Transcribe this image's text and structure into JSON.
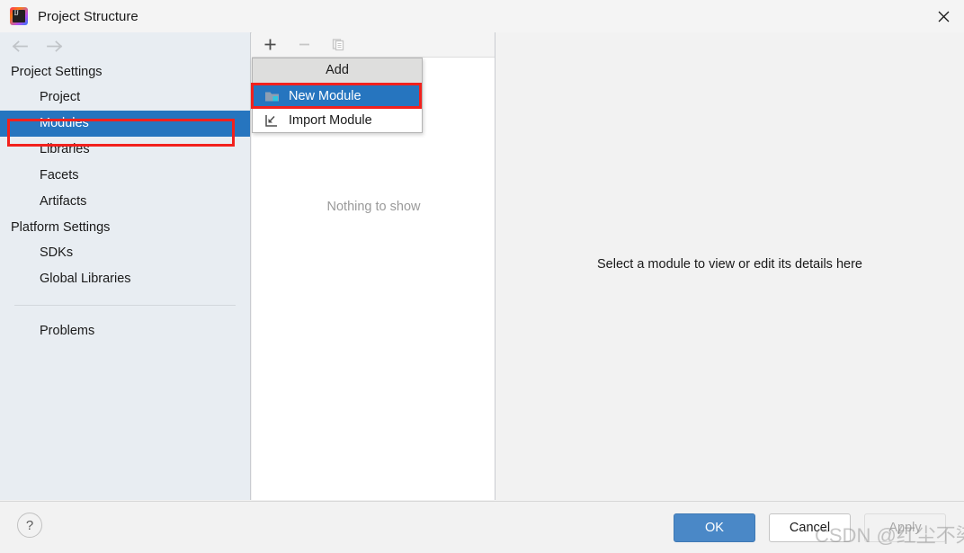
{
  "window": {
    "title": "Project Structure",
    "logo_text": "IJ",
    "close_icon": "close-icon"
  },
  "nav": {
    "back_icon": "arrow-left-icon",
    "forward_icon": "arrow-right-icon"
  },
  "sidebar": {
    "groups": [
      {
        "label": "Project Settings",
        "items": [
          {
            "label": "Project",
            "selected": false
          },
          {
            "label": "Modules",
            "selected": true
          },
          {
            "label": "Libraries",
            "selected": false
          },
          {
            "label": "Facets",
            "selected": false
          },
          {
            "label": "Artifacts",
            "selected": false
          }
        ]
      },
      {
        "label": "Platform Settings",
        "items": [
          {
            "label": "SDKs",
            "selected": false
          },
          {
            "label": "Global Libraries",
            "selected": false
          }
        ]
      }
    ],
    "problems": {
      "label": "Problems"
    }
  },
  "center": {
    "toolbar": [
      {
        "name": "add-button",
        "icon": "plus-icon",
        "enabled": true
      },
      {
        "name": "remove-button",
        "icon": "minus-icon",
        "enabled": false
      },
      {
        "name": "copy-button",
        "icon": "copy-icon",
        "enabled": false
      }
    ],
    "empty_text": "Nothing to show"
  },
  "detail": {
    "hint_text": "Select a module to view or edit its details here"
  },
  "add_menu": {
    "title": "Add",
    "items": [
      {
        "label": "New Module",
        "icon": "new-module-folder-icon",
        "highlighted": true
      },
      {
        "label": "Import Module",
        "icon": "import-module-icon",
        "highlighted": false
      }
    ]
  },
  "footer": {
    "help_label": "?",
    "ok_label": "OK",
    "cancel_label": "Cancel",
    "apply_label": "Apply"
  },
  "watermark": {
    "text": "CSDN @红尘不染"
  },
  "colors": {
    "accent_selection": "#2675bf",
    "annotation_red": "#f2211d",
    "ok_button": "#4a88c7",
    "sidebar_bg": "#e8edf2"
  }
}
